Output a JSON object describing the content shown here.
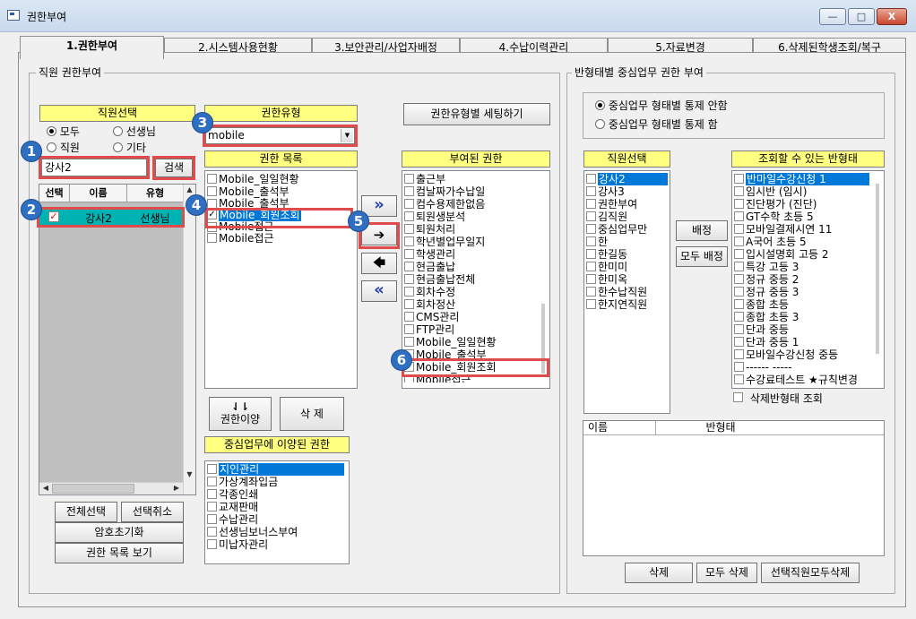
{
  "window": {
    "title": "권한부여",
    "btn_minimize": "—",
    "btn_maximize": "□",
    "btn_close": "X"
  },
  "tabs": [
    "1.권한부여",
    "2.시스템사용현황",
    "3.보안관리/사업자배정",
    "4.수납이력관리",
    "5.자료변경",
    "6.삭제된학생조회/복구"
  ],
  "left_group": {
    "label": "직원 권한부여"
  },
  "staff_select": {
    "header": "직원선택",
    "radios": [
      "모두",
      "선생님",
      "직원",
      "기타"
    ],
    "search_value": "강사2",
    "search_button": "검색",
    "columns": [
      "선택",
      "이름",
      "유형"
    ],
    "rows": [
      {
        "name": "강사2",
        "type": "선생님"
      }
    ],
    "btn_select_all": "전체선택",
    "btn_deselect": "선택취소",
    "btn_reset_pw": "암호초기화",
    "btn_view_list": "권한 목록 보기"
  },
  "perm_type": {
    "header": "권한유형",
    "value": "mobile",
    "dropdown_arrow": "▼"
  },
  "perm_list": {
    "header": "권한 목록",
    "items": [
      "Mobile_일일현황",
      "Mobile_출석부",
      "Mobile_출석부",
      "Mobile_회원조회",
      "Mobile접근",
      "Mobile접근"
    ]
  },
  "set_by_type_button": "권한유형별 세팅하기",
  "transfer_buttons": [
    "»",
    "➔",
    "🡄",
    "«"
  ],
  "granted": {
    "header": "부여된 권한",
    "items": [
      "출근부",
      "컴날짜가수납일",
      "컴수용제한없음",
      "퇴원생분석",
      "퇴원처리",
      "학년별업무일지",
      "학생관리",
      "현금출납",
      "현금출납전체",
      "회차수정",
      "회차정산",
      "CMS관리",
      "FTP관리",
      "Mobile_일일현황",
      "Mobile_출석부",
      "Mobile_회원조회",
      "Mobile접근"
    ]
  },
  "move_button": "권한이양",
  "delete_button": "삭 제",
  "core_transferred": {
    "header": "중심업무에 이양된 권한",
    "items": [
      "지인관리",
      "가상계좌입금",
      "각종인쇄",
      "교재판매",
      "수납관리",
      "선생님보너스부여",
      "미납자관리"
    ]
  },
  "right_group": {
    "label": "반형태별 중심업무 권한 부여",
    "radio_no_control": "중심업무 형태별 통제 안함",
    "radio_control": "중심업무 형태별 통제 함"
  },
  "right_staff": {
    "header": "직원선택",
    "items": [
      "강사2",
      "강사3",
      "권한부여",
      "김직원",
      "중심업무만",
      "한",
      "한길동",
      "한미미",
      "한미옥",
      "한수납직원",
      "한지연직원"
    ]
  },
  "class_types": {
    "header": "조회할 수 있는 반형태",
    "items": [
      "반마일수강신청 1",
      "임시반 (임시)",
      "진단평가 (진단)",
      "GT수학 초등 5",
      "모바일결제시연 11",
      "A국어 초등 5",
      "입시설명회 고등 2",
      "특강 고등 3",
      "정규 중등 2",
      "정규 중등 3",
      "종합 초등",
      "종합 초등 3",
      "단과 중등",
      "단과 중등 1",
      "모바일수강신청 중등",
      "------ -----",
      "수강료테스트 ★규칙변경"
    ],
    "show_deleted_label": "삭제반형태 조회"
  },
  "assign_button": "배정",
  "assign_all_button": "모두 배정",
  "assigned_table": {
    "columns": [
      "이름",
      "반형태"
    ]
  },
  "bottom_buttons": [
    "삭제",
    "모두 삭제",
    "선택직원모두삭제"
  ],
  "badges": [
    "1",
    "2",
    "3",
    "4",
    "5",
    "6"
  ]
}
